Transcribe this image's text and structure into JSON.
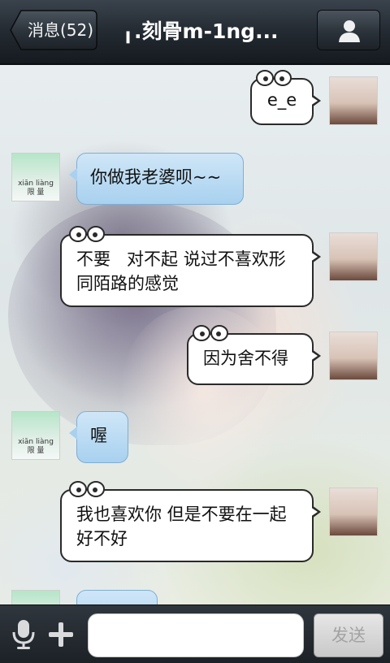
{
  "header": {
    "back_label": "消息(52)",
    "title": "╻.刻骨m-1ng...",
    "profile_icon": "person-icon"
  },
  "messages": [
    {
      "side": "right",
      "style": "white",
      "text": "e_e"
    },
    {
      "side": "left",
      "style": "blue",
      "text": "你做我老婆呗~~"
    },
    {
      "side": "right",
      "style": "white",
      "text": "不要   对不起 说过不喜欢形同陌路的感觉"
    },
    {
      "side": "right",
      "style": "white",
      "text": "因为舍不得"
    },
    {
      "side": "left",
      "style": "blue",
      "text": "喔"
    },
    {
      "side": "right",
      "style": "white",
      "text": "我也喜欢你  但是不要在一起好不好"
    }
  ],
  "avatars": {
    "contact_caption_1": "xiān  liàng",
    "contact_caption_2": "限  量"
  },
  "composer": {
    "input_value": "",
    "send_label": "发送",
    "mic_icon": "microphone-icon",
    "plus_icon": "plus-icon"
  }
}
